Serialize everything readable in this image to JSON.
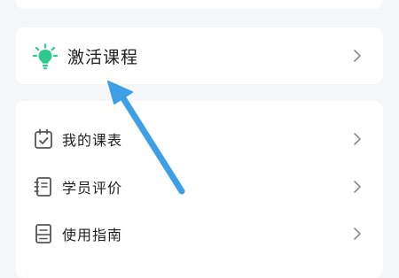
{
  "activate": {
    "label": "激活课程",
    "icon": "lightbulb-icon",
    "accent": "#2cc990"
  },
  "menu": {
    "items": [
      {
        "label": "我的课表",
        "icon": "calendar-check-icon"
      },
      {
        "label": "学员评价",
        "icon": "notebook-icon"
      },
      {
        "label": "使用指南",
        "icon": "guide-book-icon"
      }
    ]
  },
  "colors": {
    "background": "#f5f6f8",
    "card": "#ffffff",
    "icon_gray": "#555555",
    "arrow_blue": "#3d9fe6"
  }
}
